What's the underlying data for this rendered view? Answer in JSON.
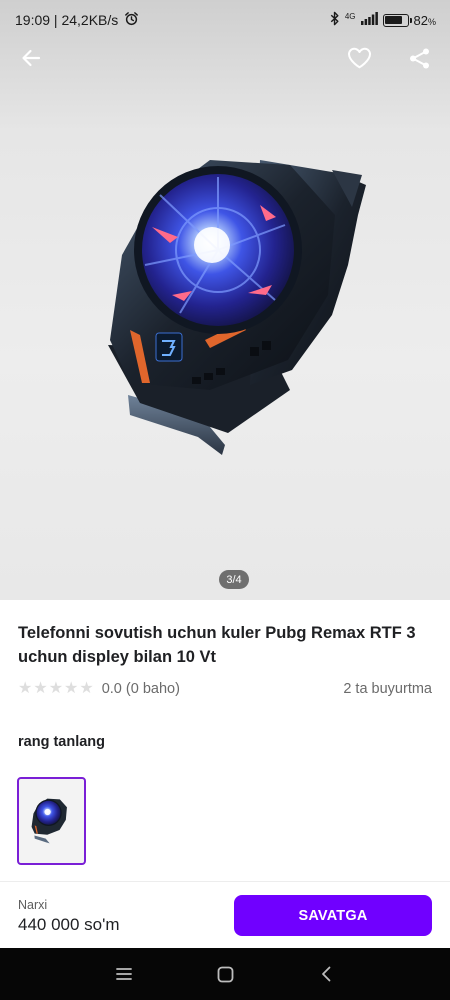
{
  "status_bar": {
    "time_speed": "19:09 | 24,2KB/s",
    "network_type": "4G",
    "battery_percent": "82",
    "battery_symbol": "%",
    "battery_level": 0.82,
    "icons": [
      "alarm-clock-icon",
      "bluetooth-icon",
      "signal-icon",
      "battery-icon"
    ]
  },
  "header": {
    "icons": [
      "back-arrow-icon",
      "heart-icon",
      "share-icon"
    ]
  },
  "gallery": {
    "pager": "3/4"
  },
  "product": {
    "title": "Telefonni sovutish uchun kuler Pubg Remax RTF 3 uchun displey bilan 10 Vt",
    "rating_stars": 0,
    "rating_text": "0.0 (0 baho)",
    "orders": "2 ta buyurtma"
  },
  "color_section": {
    "label": "rang tanlang",
    "selected_index": 0
  },
  "bottom_bar": {
    "price_label": "Narxi",
    "price_value": "440 000 so'm",
    "button_label": "SAVATGA",
    "button_color": "#7000FF"
  },
  "nav_bar": {
    "icons": [
      "menu-icon",
      "home-icon",
      "back-icon"
    ]
  },
  "colors": {
    "accent": "#7000FF",
    "thumb_border": "#7A1FD6"
  }
}
